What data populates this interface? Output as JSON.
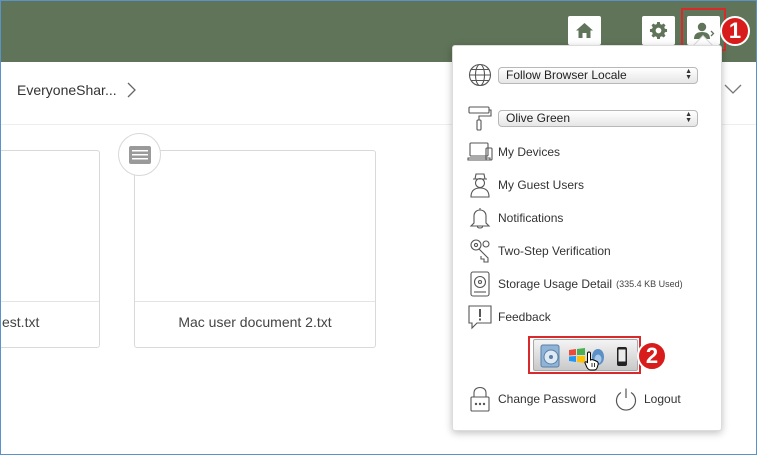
{
  "header": {
    "home_icon": "home-icon",
    "settings_icon": "gear-icon",
    "user_icon": "user-icon",
    "accent": "#5f7458"
  },
  "breadcrumb": {
    "folder": "EveryoneShar..."
  },
  "files": [
    {
      "name": "est.txt"
    },
    {
      "name": "Mac user document 2.txt"
    }
  ],
  "menu": {
    "locale_value": "Follow Browser Locale",
    "theme_value": "Olive Green",
    "items": [
      {
        "label": "My Devices"
      },
      {
        "label": "My Guest Users"
      },
      {
        "label": "Notifications"
      },
      {
        "label": "Two-Step Verification"
      },
      {
        "label": "Storage Usage Detail",
        "detail": "(335.4 KB Used)"
      },
      {
        "label": "Feedback"
      }
    ],
    "change_password": "Change Password",
    "logout": "Logout"
  },
  "callouts": {
    "one": "1",
    "two": "2",
    "color": "#d81c1c"
  }
}
